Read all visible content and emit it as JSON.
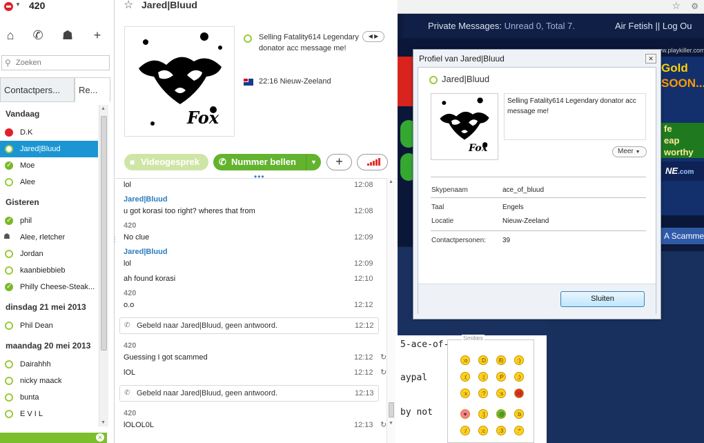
{
  "sidebar": {
    "me_name": "420",
    "search_placeholder": "Zoeken",
    "tabs": [
      "Contactpers...",
      "Re..."
    ],
    "groups": [
      {
        "label": "Vandaag",
        "contacts": [
          {
            "name": "D.K",
            "status": "dnd"
          },
          {
            "name": "Jared|Bluud",
            "status": "offline",
            "selected": true
          },
          {
            "name": "Moe",
            "status": "online"
          },
          {
            "name": "Alee",
            "status": "offline"
          }
        ]
      },
      {
        "label": "Gisteren",
        "contacts": [
          {
            "name": "phil",
            "status": "online"
          },
          {
            "name": "Alee, ғletcher",
            "status": "group"
          },
          {
            "name": "Jordan",
            "status": "offline"
          },
          {
            "name": "kaanbiebbieb",
            "status": "offline"
          },
          {
            "name": "Philly Cheese-Steak...",
            "status": "online"
          }
        ]
      },
      {
        "label": "dinsdag 21 mei 2013",
        "contacts": [
          {
            "name": "Phil Dean",
            "status": "offline"
          }
        ]
      },
      {
        "label": "maandag 20 mei 2013",
        "contacts": [
          {
            "name": "Dairahhh",
            "status": "offline"
          },
          {
            "name": "nicky maack",
            "status": "offline"
          },
          {
            "name": "bunta",
            "status": "offline"
          },
          {
            "name": "E V I L",
            "status": "offline"
          }
        ]
      }
    ]
  },
  "conversation": {
    "title": "Jared|Bluud",
    "mood_message": "Selling Fatality614 Legendary donator acc message me!",
    "local_time": "22:16 Nieuw-Zeeland",
    "video_button": "Videogesprek",
    "call_button": "Nummer bellen",
    "messages": [
      {
        "type": "msg",
        "text": "lol",
        "time": "12:08"
      },
      {
        "type": "author",
        "name": "Jared|Bluud",
        "peer": true
      },
      {
        "type": "msg",
        "text": "u got korasi too right? wheres that from",
        "time": "12:08"
      },
      {
        "type": "author",
        "name": "420",
        "peer": false
      },
      {
        "type": "msg",
        "text": "No clue",
        "time": "12:09"
      },
      {
        "type": "author",
        "name": "Jared|Bluud",
        "peer": true
      },
      {
        "type": "msg",
        "text": "lol",
        "time": "12:09"
      },
      {
        "type": "msg",
        "text": "ah found korasi",
        "time": "12:10"
      },
      {
        "type": "author",
        "name": "420",
        "peer": false
      },
      {
        "type": "msg",
        "text": "o.o",
        "time": "12:12"
      },
      {
        "type": "call",
        "text": "Gebeld naar Jared|Bluud, geen antwoord.",
        "time": "12:12"
      },
      {
        "type": "author",
        "name": "420",
        "peer": false
      },
      {
        "type": "msg",
        "text": "Guessing I got scammed",
        "time": "12:12",
        "pending": true
      },
      {
        "type": "msg",
        "text": "lOL",
        "time": "12:12",
        "pending": true
      },
      {
        "type": "call",
        "text": "Gebeld naar Jared|Bluud, geen antwoord.",
        "time": "12:13"
      },
      {
        "type": "author",
        "name": "420",
        "peer": false
      },
      {
        "type": "msg",
        "text": "lOLOL0L",
        "time": "12:13",
        "pending": true
      }
    ]
  },
  "browser": {
    "pm_label": "Private Messages:",
    "pm_count": "Unread 0, Total 7.",
    "nav_links": "Air Fetish || Log Ou",
    "banner_url": "www.playkiller.com",
    "ad_gold": "Gold",
    "ad_soon": "SOON...",
    "ad_fe": [
      "fe",
      "eap",
      "worthy"
    ],
    "ad_ne": "NE",
    "ad_ne_suffix": ".com",
    "scam_strip": "A Scamme",
    "forum_lines": [
      "5-ace-of-",
      "aypal",
      "by not"
    ],
    "smilies_title": "Smilies"
  },
  "profile": {
    "window_title": "Profiel van Jared|Bluud",
    "name": "Jared|Bluud",
    "mood": "Selling Fatality614 Legendary donator acc message me!",
    "more_button": "Meer",
    "fields": [
      {
        "label": "Skypenaam",
        "value": "ace_of_bluud"
      },
      {
        "label": "Taal",
        "value": "Engels"
      },
      {
        "label": "Locatie",
        "value": "Nieuw-Zeeland"
      },
      {
        "label": "Contactpersonen:",
        "value": "39"
      }
    ],
    "close_button": "Sluiten"
  },
  "colors": {
    "skype_blue": "#1b96d2",
    "online_green": "#7ab929",
    "call_green": "#63b32e",
    "dnd_red": "#e0202a",
    "peer_name_blue": "#2c7cc1"
  }
}
